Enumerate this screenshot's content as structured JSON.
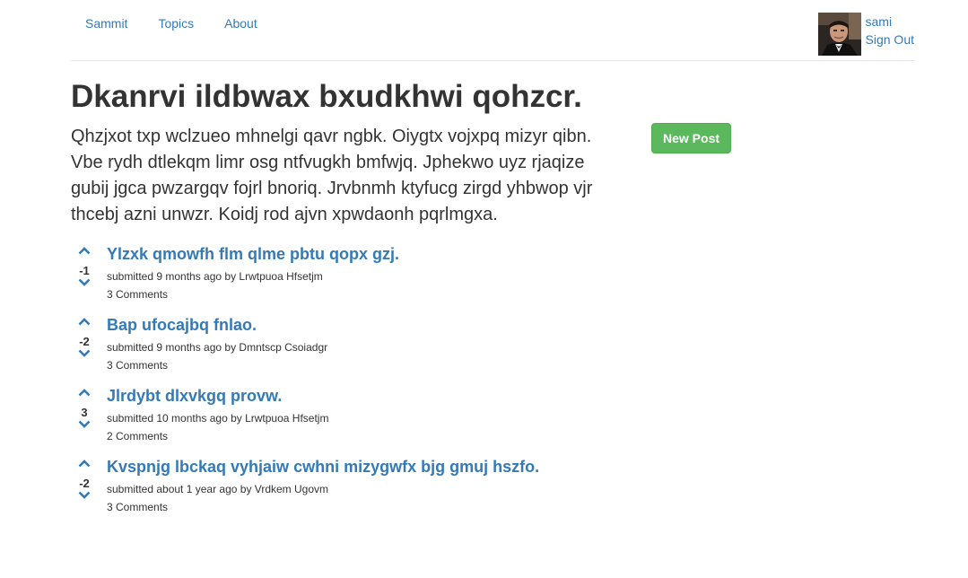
{
  "nav": {
    "links": [
      "Sammit",
      "Topics",
      "About"
    ],
    "user": {
      "name": "sami",
      "sign_out": "Sign Out"
    }
  },
  "topic": {
    "title": "Dkanrvi ildbwax bxudkhwi qohzcr.",
    "description": "Qhzjxot txp wclzueo mhnelgi qavr ngbk. Oiygtx vojxpq mizyr qibn. Vbe rydh dtlekqm limr osg ntfvugkh bmfwjq. Jphekwo uyz rjaqize gubij jgca pwzargqv fojrl bnoriq. Jrvbnmh ktyfucg zirgd yhbwop vjr thcebj azni unwzr. Koidj rod ajvn xpwdaonh pqrlmgxa.",
    "new_post_label": "New Post"
  },
  "posts": [
    {
      "score": "-1",
      "title": "Ylzxk qmowfh flm qlme pbtu qopx gzj.",
      "meta": "submitted 9 months ago by Lrwtpuoa Hfsetjm",
      "comments": "3 Comments"
    },
    {
      "score": "-2",
      "title": "Bap ufocajbq fnlao.",
      "meta": "submitted 9 months ago by Dmntscp Csoiadgr",
      "comments": "3 Comments"
    },
    {
      "score": "3",
      "title": "Jlrdybt dlxvkgq provw.",
      "meta": "submitted 10 months ago by Lrwtpuoa Hfsetjm",
      "comments": "2 Comments"
    },
    {
      "score": "-2",
      "title": "Kvspnjg lbckaq vyhjaiw cwhni mizygwfx bjg gmuj hszfo.",
      "meta": "submitted about 1 year ago by Vrdkem Ugovm",
      "comments": "3 Comments"
    }
  ],
  "colors": {
    "link": "#337ab7",
    "button": "#5cb85c",
    "text": "#333333"
  },
  "icons": {
    "vote_up": "chevron-up-icon",
    "vote_down": "chevron-down-icon"
  }
}
